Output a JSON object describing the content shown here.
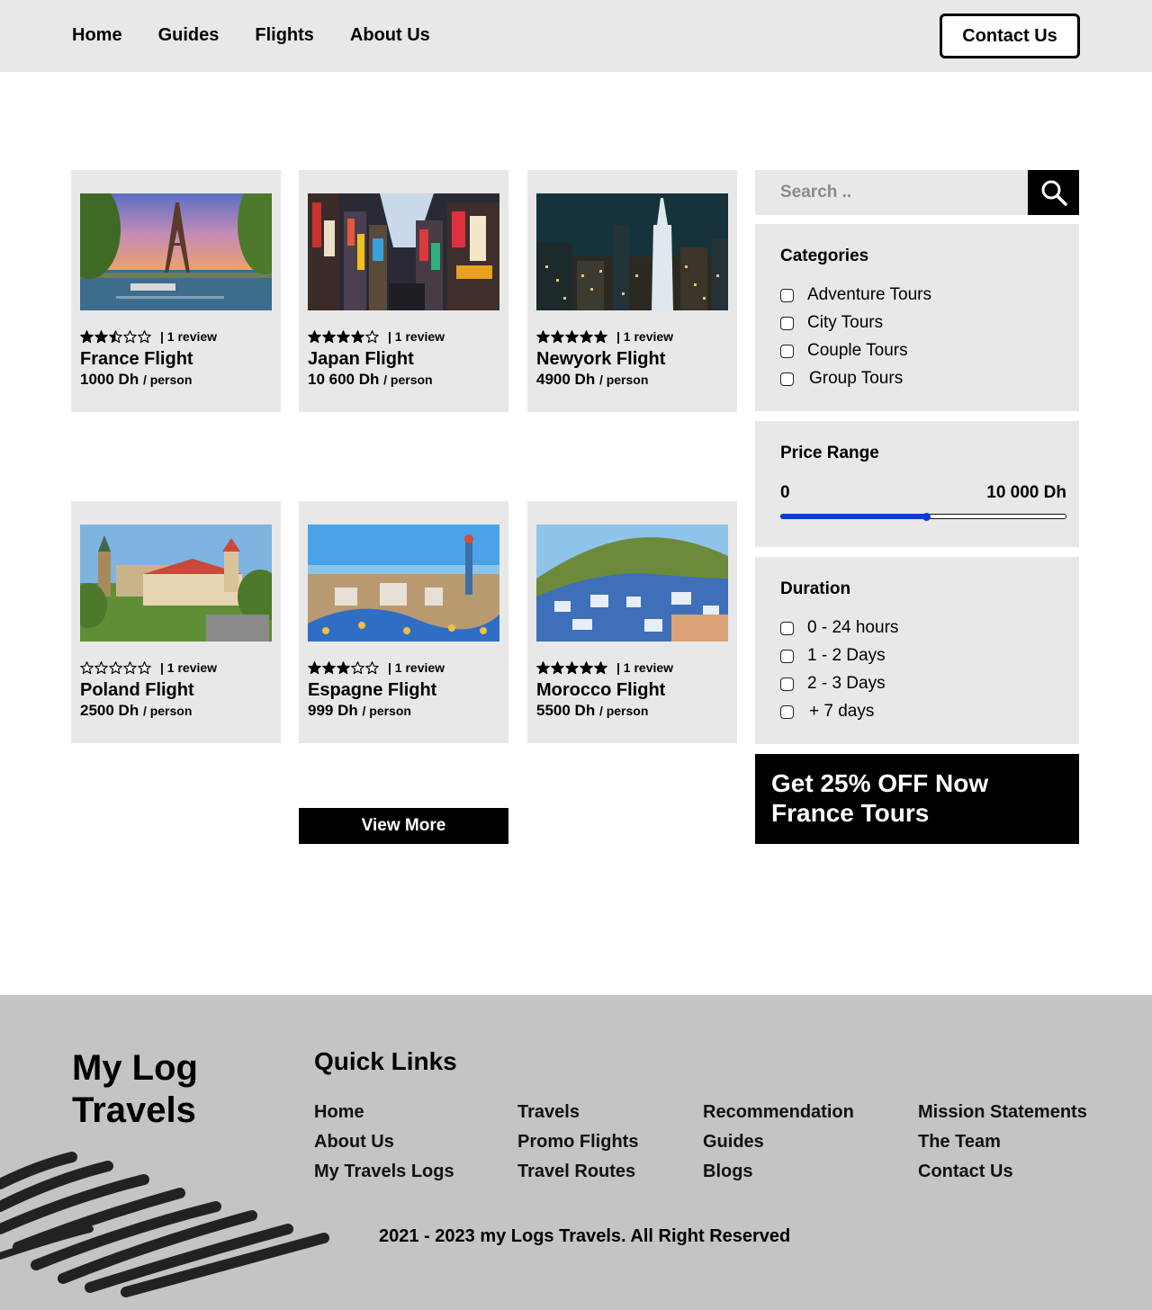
{
  "nav": {
    "links": [
      "Home",
      "Guides",
      "Flights",
      "About Us"
    ],
    "contact": "Contact Us"
  },
  "cards": [
    {
      "title": "France Flight",
      "price": "1000 Dh",
      "per": "/ person",
      "reviews": "| 1 review",
      "rating": 2.5,
      "image": "eiffel-tower-photo"
    },
    {
      "title": "Japan Flight",
      "price": "10 600 Dh",
      "per": "/ person",
      "reviews": "| 1 review",
      "rating": 4,
      "image": "tokyo-street-photo"
    },
    {
      "title": "Newyork Flight",
      "price": "4900 Dh",
      "per": "/ person",
      "reviews": "| 1 review",
      "rating": 5,
      "image": "new-york-night-photo"
    },
    {
      "title": "Poland Flight",
      "price": "2500 Dh",
      "per": "/ person",
      "reviews": "| 1 review",
      "rating": 0,
      "image": "krakow-castle-photo"
    },
    {
      "title": "Espagne Flight",
      "price": "999 Dh",
      "per": "/ person",
      "reviews": "| 1 review",
      "rating": 3,
      "image": "barcelona-park-photo"
    },
    {
      "title": "Morocco Flight",
      "price": "5500 Dh",
      "per": "/ person",
      "reviews": "| 1 review",
      "rating": 5,
      "image": "chefchaouen-photo"
    }
  ],
  "view_more": "View More",
  "search": {
    "placeholder": "Search ..",
    "icon": "search-icon"
  },
  "categories": {
    "title": "Categories",
    "items": [
      "Adventure Tours",
      "City Tours",
      "Couple Tours",
      "Group Tours"
    ]
  },
  "price_range": {
    "title": "Price Range",
    "min_label": "0",
    "max_label": "10 000 Dh",
    "value_fraction": 0.51,
    "accent": "#0a3ccf"
  },
  "duration": {
    "title": "Duration",
    "items": [
      "0 - 24 hours",
      "1 - 2 Days",
      "2 - 3 Days",
      "+ 7 days"
    ]
  },
  "promo": "Get 25% OFF Now France Tours",
  "footer": {
    "logo_line1": "My Log",
    "logo_line2": "Travels",
    "quick_links_title": "Quick Links",
    "columns": [
      [
        "Home",
        "About Us",
        "My Travels Logs"
      ],
      [
        "Travels",
        "Promo Flights",
        "Travel Routes"
      ],
      [
        "Recommendation",
        "Guides",
        "Blogs"
      ],
      [
        "Mission Statements",
        "The Team",
        "Contact Us"
      ]
    ],
    "copyright": "2021 - 2023 my Logs Travels. All Right Reserved"
  }
}
